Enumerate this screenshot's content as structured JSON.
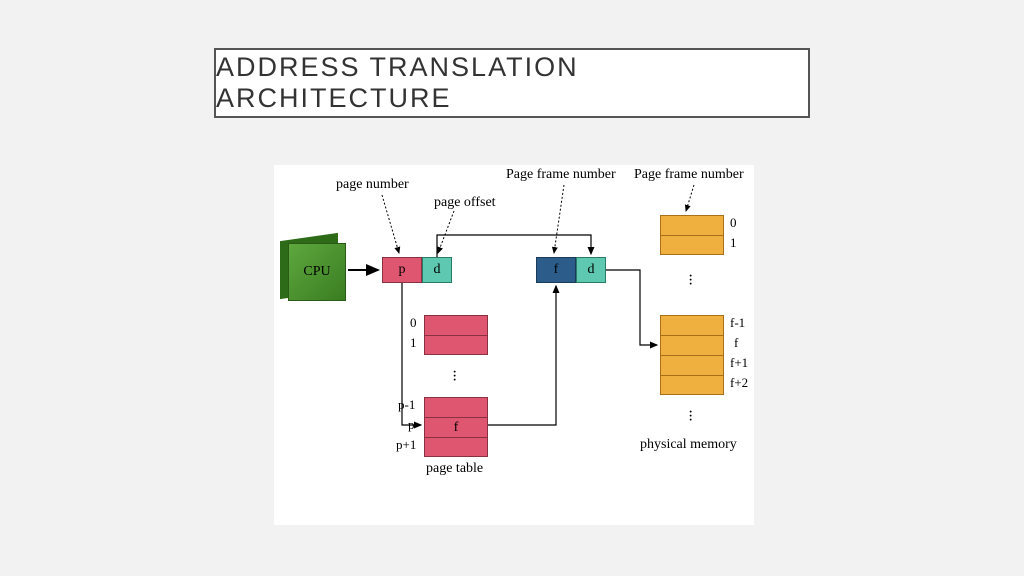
{
  "title": "ADDRESS TRANSLATION ARCHITECTURE",
  "cpu": "CPU",
  "logical": {
    "p": "p",
    "d": "d"
  },
  "physical": {
    "f": "f",
    "d": "d"
  },
  "labels": {
    "page_number": "page number",
    "page_offset": "page offset",
    "pfn1": "Page frame number",
    "pfn2": "Page frame number",
    "page_table": "page table",
    "physical_memory": "physical memory"
  },
  "pt_indices": {
    "i0": "0",
    "i1": "1",
    "pm1": "p-1",
    "p": "p",
    "pp1": "p+1",
    "f": "f"
  },
  "pm_indices": {
    "i0": "0",
    "i1": "1",
    "fm1": "f-1",
    "f": "f",
    "fp1": "f+1",
    "fp2": "f+2"
  }
}
